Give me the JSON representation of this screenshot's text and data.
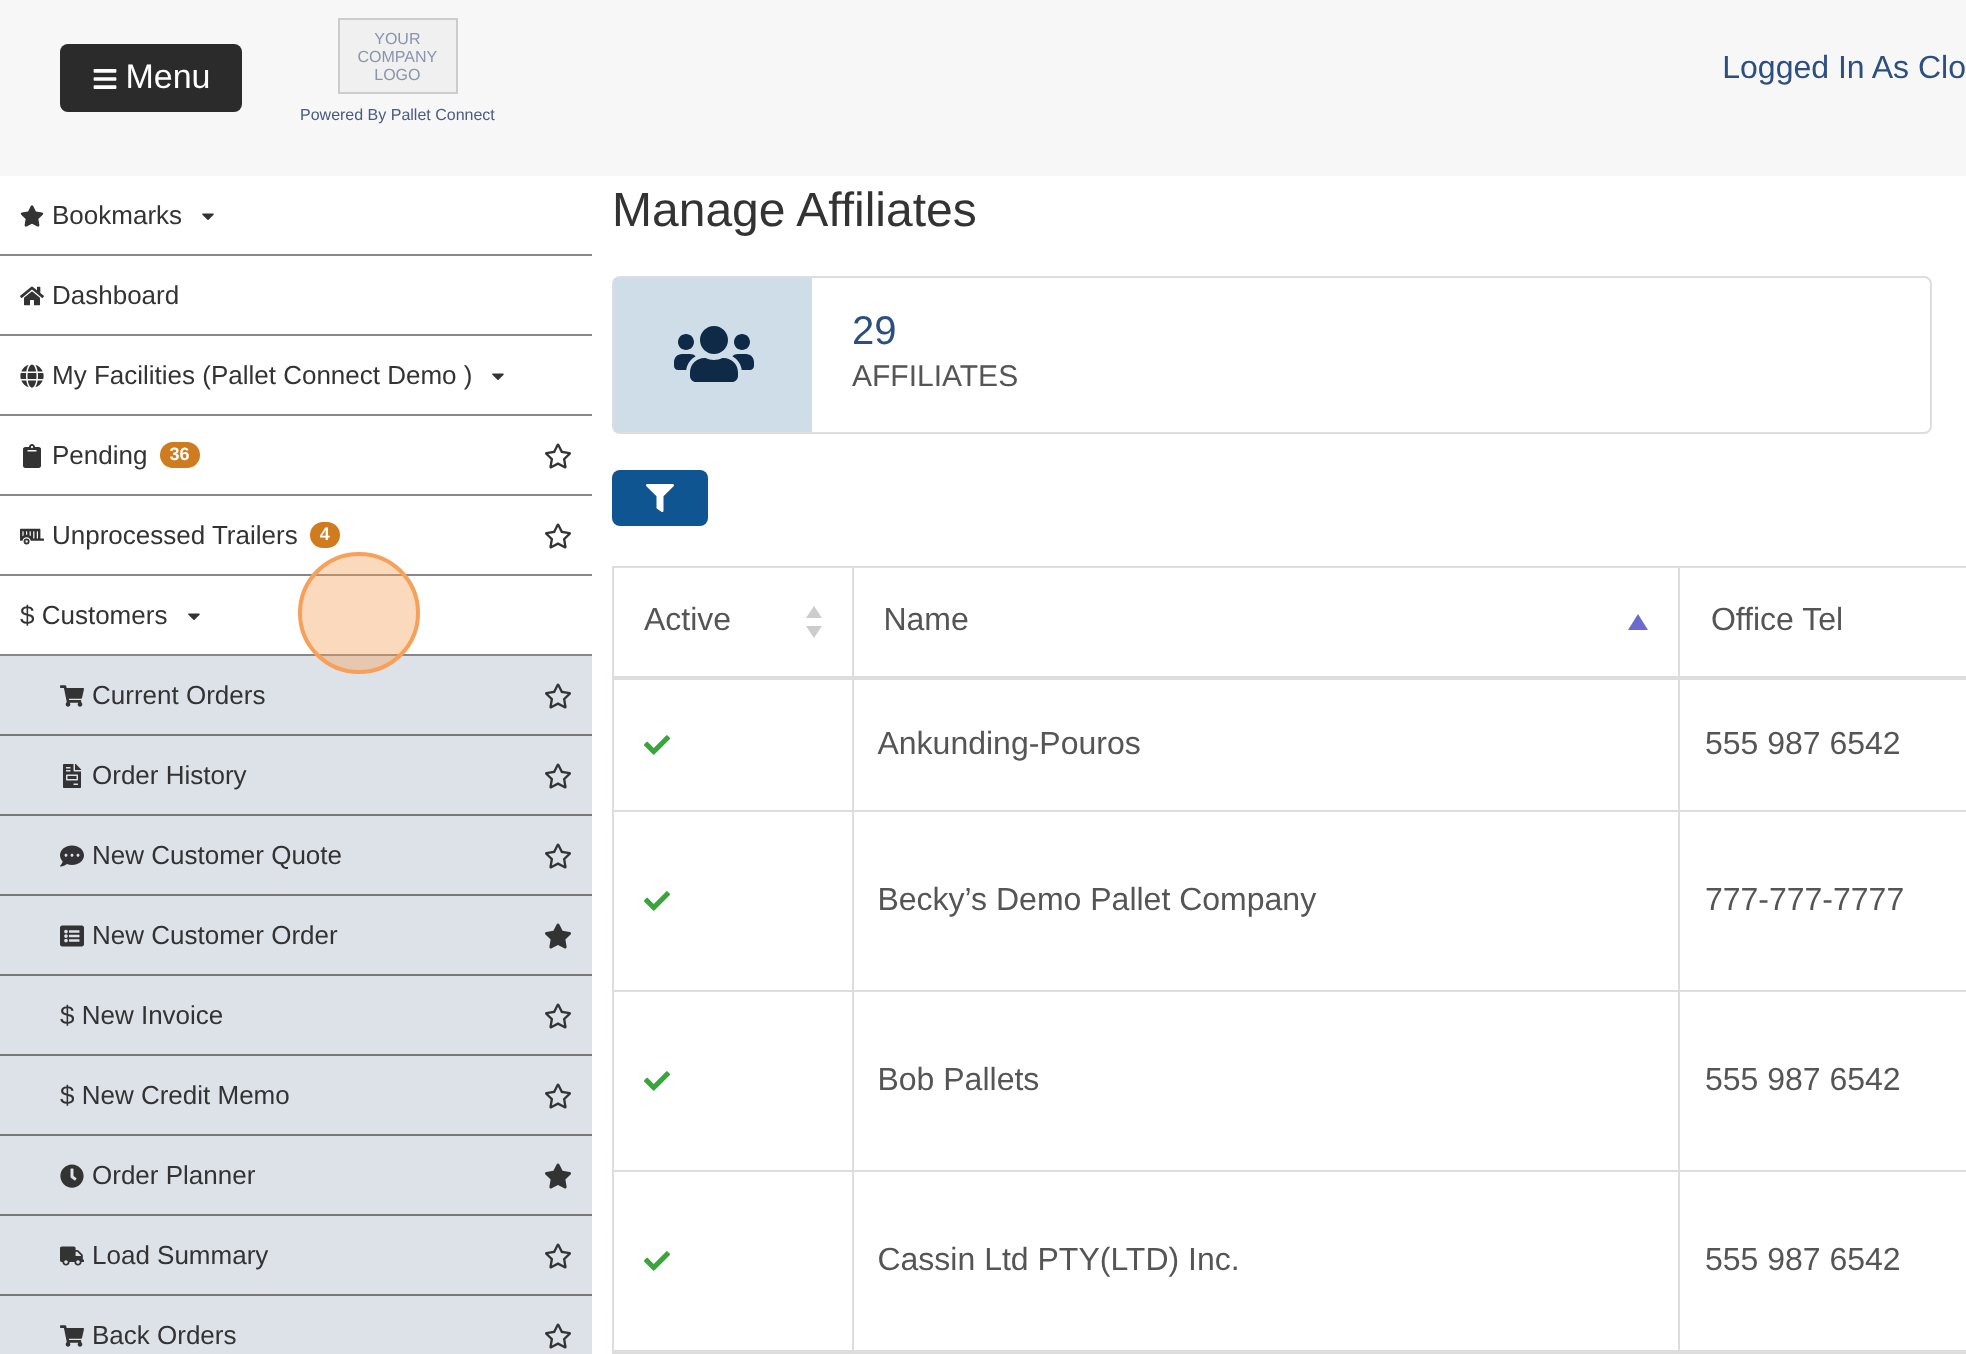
{
  "header": {
    "menu_button": "Menu",
    "logo": {
      "lines": [
        "YOUR",
        "COMPANY",
        "LOGO"
      ]
    },
    "powered_by": "Powered By Pallet Connect",
    "logged_in": "Logged In As Clo"
  },
  "sidebar": {
    "items": [
      {
        "label": "Bookmarks",
        "dropdown": true
      },
      {
        "label": "Dashboard",
        "dropdown": false
      },
      {
        "label": "My Facilities (Pallet Connect Demo )",
        "dropdown": true
      },
      {
        "label": "Pending",
        "dropdown": false,
        "badge": "36",
        "bookmarked": false
      },
      {
        "label": "Unprocessed Trailers",
        "dropdown": false,
        "badge": "4",
        "bookmarked": false
      },
      {
        "label": "$ Customers",
        "dropdown": true,
        "expanded": true,
        "children": [
          {
            "label": "Current Orders",
            "bookmarked": false
          },
          {
            "label": "Order History",
            "bookmarked": false
          },
          {
            "label": "New Customer Quote",
            "bookmarked": false
          },
          {
            "label": "New Customer Order",
            "bookmarked": true
          },
          {
            "label": "$ New Invoice",
            "bookmarked": false
          },
          {
            "label": "$ New Credit Memo",
            "bookmarked": false
          },
          {
            "label": "Order Planner",
            "bookmarked": true
          },
          {
            "label": "Load Summary",
            "bookmarked": false
          },
          {
            "label": "Back Orders",
            "bookmarked": false
          }
        ]
      }
    ]
  },
  "page": {
    "title": "Manage Affiliates",
    "stat": {
      "count": "29",
      "label": "AFFILIATES"
    },
    "table": {
      "columns": [
        {
          "label": "Active",
          "sorted": false
        },
        {
          "label": "Name",
          "sorted": true
        },
        {
          "label": "Office Tel"
        }
      ],
      "rows": [
        {
          "active": true,
          "name": "Ankunding-Pouros",
          "office_tel": "555 987 6542"
        },
        {
          "active": true,
          "name": "Becky’s Demo Pallet Company",
          "office_tel": "777-777-7777"
        },
        {
          "active": true,
          "name": "Bob Pallets",
          "office_tel": "555 987 6542"
        },
        {
          "active": true,
          "name": "Cassin Ltd PTY(LTD) Inc.",
          "office_tel": "555 987 6542"
        }
      ]
    }
  }
}
